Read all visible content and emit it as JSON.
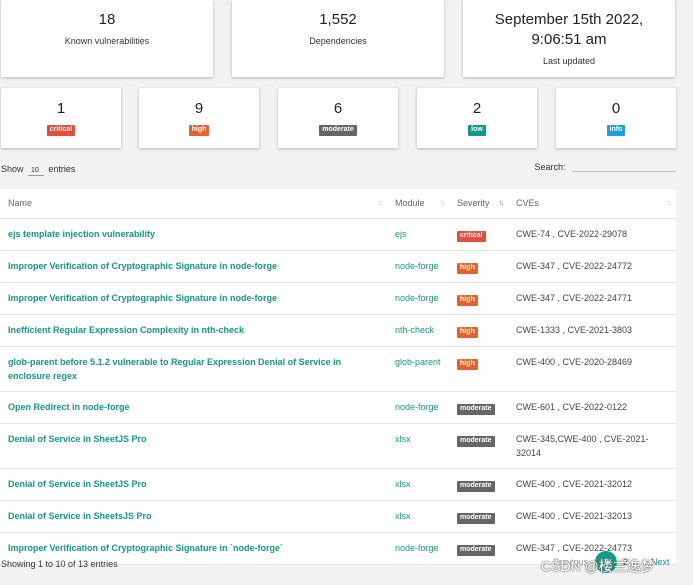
{
  "summary": {
    "known_vulnerabilities": {
      "value": "18",
      "label": "Known vulnerabilities"
    },
    "dependencies": {
      "value": "1,552",
      "label": "Dependencies"
    },
    "last_updated": {
      "date": "September 15th 2022,",
      "time": "9:06:51 am",
      "label": "Last updated"
    }
  },
  "severity_counts": [
    {
      "count": "1",
      "label": "critical"
    },
    {
      "count": "9",
      "label": "high"
    },
    {
      "count": "6",
      "label": "moderate"
    },
    {
      "count": "2",
      "label": "low"
    },
    {
      "count": "0",
      "label": "info"
    }
  ],
  "colors": {
    "critical": "#e74c3c",
    "high": "#e8612c",
    "moderate": "#666666",
    "low": "#119a86",
    "info": "#1aa0e0",
    "accent": "#119a86"
  },
  "controls": {
    "show_label": "Show",
    "entries_value": "10",
    "entries_label": "entries",
    "search_label": "Search:"
  },
  "table": {
    "headers": {
      "name": "Name",
      "module": "Module",
      "severity": "Severity",
      "cves": "CVEs"
    },
    "rows": [
      {
        "name": "ejs template injection vulnerability",
        "module": "ejs",
        "severity": "critical",
        "cves": "CWE-74 , CVE-2022-29078"
      },
      {
        "name": "Improper Verification of Cryptographic Signature in node-forge",
        "module": "node-forge",
        "severity": "high",
        "cves": "CWE-347 , CVE-2022-24772"
      },
      {
        "name": "Improper Verification of Cryptographic Signature in node-forge",
        "module": "node-forge",
        "severity": "high",
        "cves": "CWE-347 , CVE-2022-24771"
      },
      {
        "name": "Inefficient Regular Expression Complexity in nth-check",
        "module": "nth-check",
        "severity": "high",
        "cves": "CWE-1333 , CVE-2021-3803"
      },
      {
        "name": "glob-parent before 5.1.2 vulnerable to Regular Expression Denial of Service in enclosure regex",
        "module": "glob-parent",
        "severity": "high",
        "cves": "CWE-400 , CVE-2020-28469"
      },
      {
        "name": "Open Redirect in node-forge",
        "module": "node-forge",
        "severity": "moderate",
        "cves": "CWE-601 , CVE-2022-0122"
      },
      {
        "name": "Denial of Service in SheetJS Pro",
        "module": "xlsx",
        "severity": "moderate",
        "cves": "CWE-345,CWE-400 , CVE-2021-32014"
      },
      {
        "name": "Denial of Service in SheetJS Pro",
        "module": "xlsx",
        "severity": "moderate",
        "cves": "CWE-400 , CVE-2021-32012"
      },
      {
        "name": "Denial of Service in SheetsJS Pro",
        "module": "xlsx",
        "severity": "moderate",
        "cves": "CWE-400 , CVE-2021-32013"
      },
      {
        "name": "Improper Verification of Cryptographic Signature in `node-forge`",
        "module": "node-forge",
        "severity": "moderate",
        "cves": "CWE-347 , CVE-2022-24773"
      }
    ]
  },
  "footer": {
    "info": "Showing 1 to 10 of 13 entries"
  },
  "pagination": {
    "previous": "Previous",
    "current": "1",
    "next_page": "2",
    "next": "Next"
  },
  "watermark": "CSDN @楼兰逸梦"
}
